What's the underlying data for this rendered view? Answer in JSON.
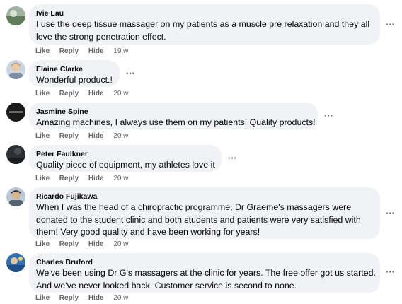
{
  "comments": [
    {
      "author": "Ivie Lau",
      "lines": [
        "I use the deep tissue massager on my patients as a muscle pre relaxation and they all",
        "love the strong penetration effect."
      ],
      "like": "Like",
      "reply": "Reply",
      "hide": "Hide",
      "time": "19 w",
      "more": "···"
    },
    {
      "author": "Elaine Clarke",
      "lines": [
        "Wonderful product.!"
      ],
      "like": "Like",
      "reply": "Reply",
      "hide": "Hide",
      "time": "20 w",
      "more": "···"
    },
    {
      "author": "Jasmine Spine",
      "lines": [
        "Amazing machines, I always use them on my patients! Quality products!"
      ],
      "like": "Like",
      "reply": "Reply",
      "hide": "Hide",
      "time": "20 w",
      "more": "···"
    },
    {
      "author": "Peter Faulkner",
      "lines": [
        "Quality piece of equipment, my athletes love it"
      ],
      "like": "Like",
      "reply": "Reply",
      "hide": "Hide",
      "time": "20 w",
      "more": "···"
    },
    {
      "author": "Ricardo Fujikawa",
      "lines": [
        "When I was the head of a chiropractic programme, Dr Graeme's massagers were",
        "donated to the student clinic and both students and patients were very satisfied with",
        "them! Very good quality and have been working for years!"
      ],
      "like": "Like",
      "reply": "Reply",
      "hide": "Hide",
      "time": "20 w",
      "more": "···"
    },
    {
      "author": "Charles Bruford",
      "lines": [
        "We've been using Dr G's massagers at the clinic for years. The free offer got us started.",
        "And we've never looked back. Customer service is second to none."
      ],
      "like": "Like",
      "reply": "Reply",
      "hide": "Hide",
      "time": "20 w",
      "more": "···"
    }
  ]
}
